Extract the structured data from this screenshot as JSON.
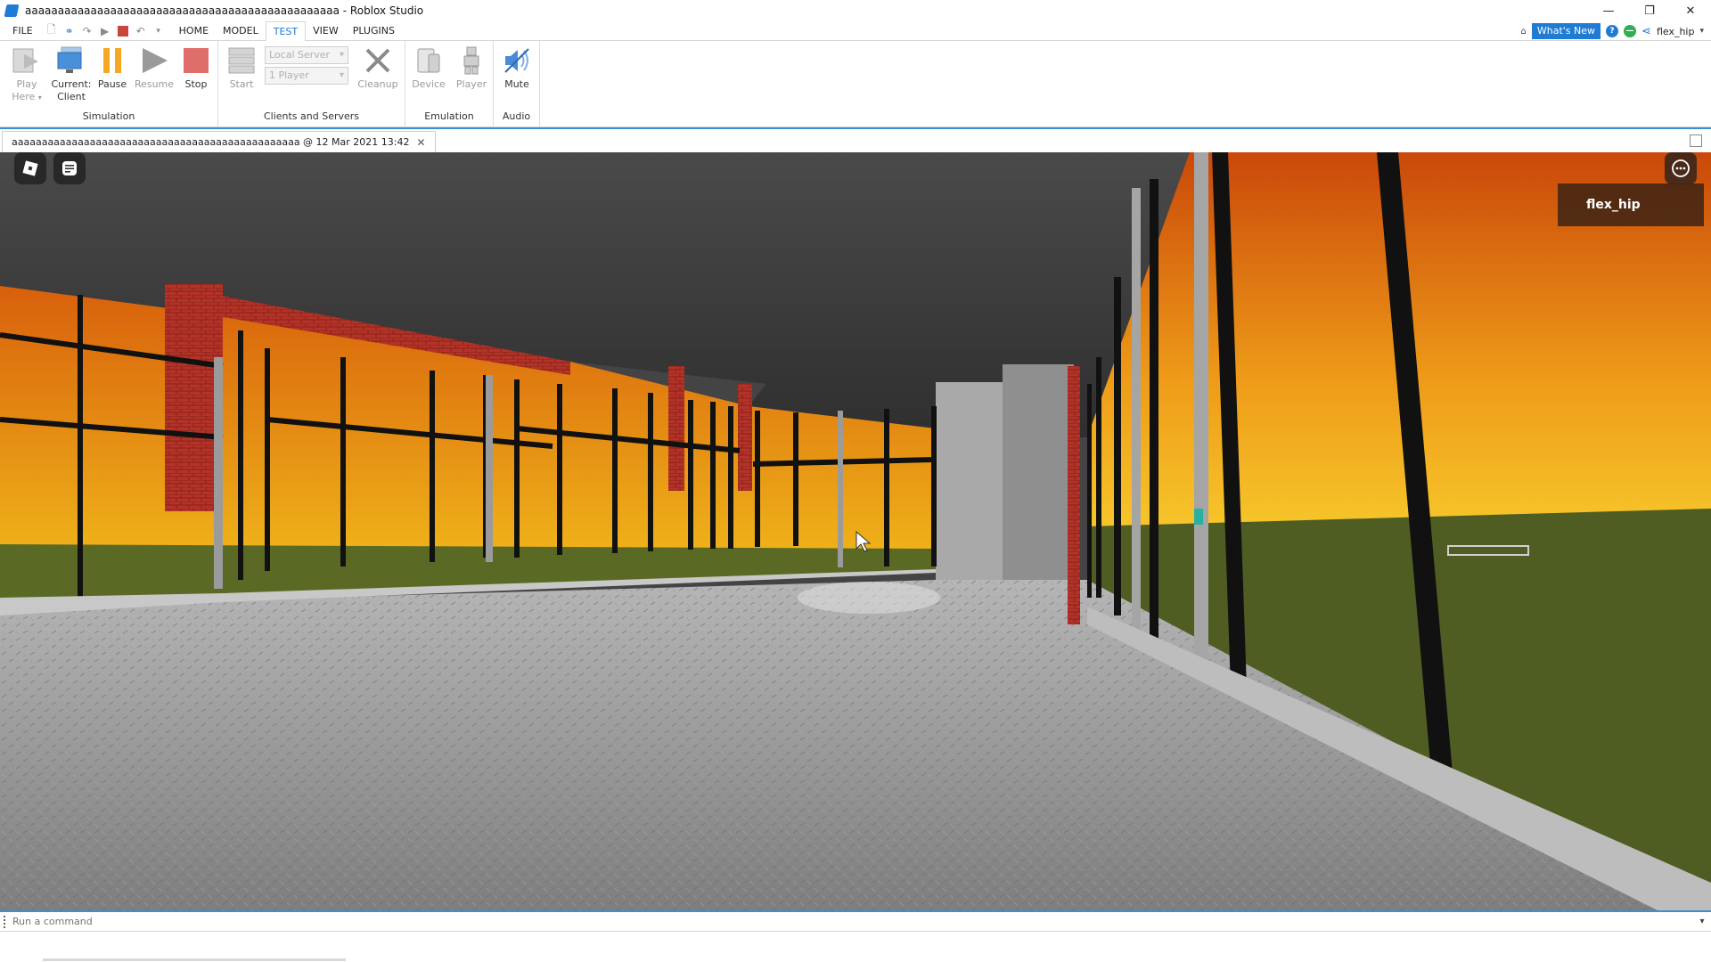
{
  "window": {
    "title": "aaaaaaaaaaaaaaaaaaaaaaaaaaaaaaaaaaaaaaaaaaaaaaaa - Roblox Studio",
    "controls": [
      "minimize-icon",
      "restore-icon",
      "close-icon"
    ]
  },
  "menu": {
    "file": "FILE",
    "tabs": [
      "HOME",
      "MODEL",
      "TEST",
      "VIEW",
      "PLUGINS"
    ],
    "active_tab": "TEST",
    "whats_new": "What's New",
    "username": "flex_hip"
  },
  "ribbon": {
    "simulation": {
      "label": "Simulation",
      "play_here": [
        "Play",
        "Here"
      ],
      "current_client": [
        "Current:",
        "Client"
      ],
      "pause": "Pause",
      "resume": "Resume",
      "stop": "Stop"
    },
    "clients_servers": {
      "label": "Clients and Servers",
      "start": "Start",
      "server_select": "Local Server",
      "player_select": "1 Player",
      "cleanup": "Cleanup"
    },
    "emulation": {
      "label": "Emulation",
      "device": "Device",
      "player": "Player"
    },
    "audio": {
      "label": "Audio",
      "mute": "Mute"
    }
  },
  "document_tab": {
    "label": "aaaaaaaaaaaaaaaaaaaaaaaaaaaaaaaaaaaaaaaaaaaaaaaa @ 12 Mar 2021 13:42"
  },
  "viewport": {
    "player_list_name": "flex_hip",
    "colors": {
      "ceiling": "#3b3b3b",
      "floor": "#8f8f8f",
      "sky_top": "#d8600c",
      "sky_bottom": "#f3c21c",
      "grass": "#4f5d22",
      "brick": "#b33328",
      "frame": "#111111",
      "concrete": "#a9a9a9"
    }
  },
  "command_bar": {
    "placeholder": "Run a command"
  }
}
